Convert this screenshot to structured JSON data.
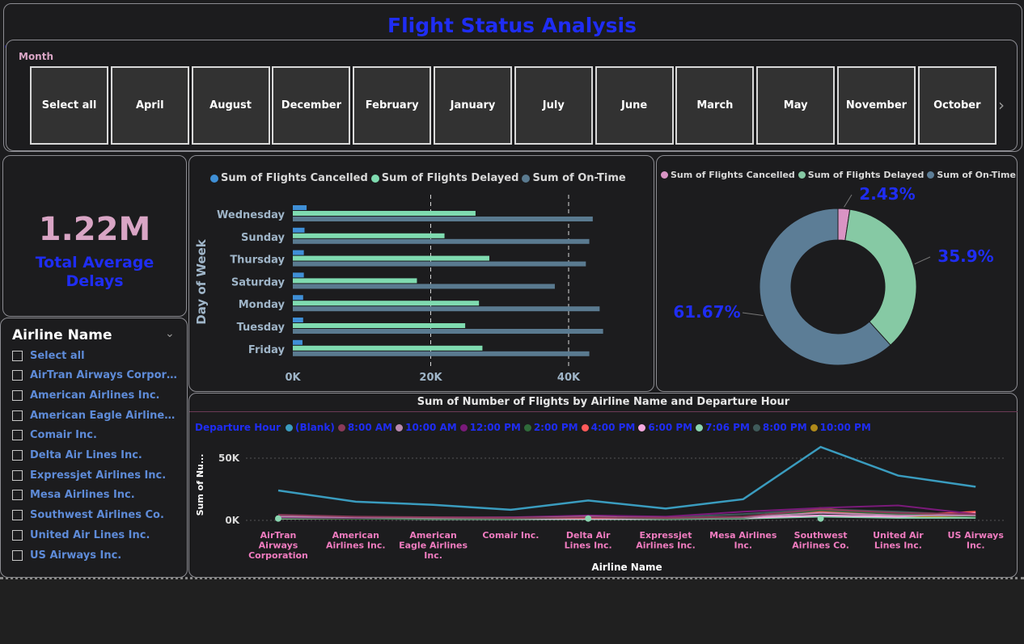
{
  "title": "Flight Status Analysis",
  "month_slicer": {
    "label": "Month",
    "items": [
      "Select all",
      "April",
      "August",
      "December",
      "February",
      "January",
      "July",
      "June",
      "March",
      "May",
      "November",
      "October"
    ],
    "scroll_icon": "chevron-right-icon"
  },
  "kpi": {
    "value": "1.22M",
    "label_line1": "Total Average",
    "label_line2": "Delays"
  },
  "airline_slicer": {
    "title": "Airline Name",
    "expand_icon": "chevron-down-icon",
    "items": [
      "Select all",
      "AirTran Airways Corporati...",
      "American Airlines Inc.",
      "American Eagle Airlines Inc.",
      "Comair Inc.",
      "Delta Air Lines Inc.",
      "Expressjet Airlines Inc.",
      "Mesa Airlines Inc.",
      "Southwest Airlines Co.",
      "United Air Lines Inc.",
      "US Airways Inc."
    ]
  },
  "colors": {
    "title": "#1f2df4",
    "kpi_value": "#d9a5c5",
    "cancelled": "#3f8fd6",
    "delayed": "#7fdbb0",
    "on_time": "#5a7a90",
    "axis_label": "#9fb5c8"
  },
  "chart_data": [
    {
      "type": "bar",
      "orientation": "horizontal",
      "ylabel": "Day of Week",
      "categories": [
        "Wednesday",
        "Sunday",
        "Thursday",
        "Saturday",
        "Monday",
        "Tuesday",
        "Friday"
      ],
      "series": [
        {
          "name": "Sum of Flights Cancelled",
          "values": [
            2000,
            1700,
            1600,
            1600,
            1500,
            1500,
            1400
          ]
        },
        {
          "name": "Sum of Flights Delayed",
          "values": [
            26500,
            22000,
            28500,
            18000,
            27000,
            25000,
            27500
          ]
        },
        {
          "name": "Sum of On-Time",
          "values": [
            43500,
            43000,
            42500,
            38000,
            44500,
            45000,
            43000
          ]
        }
      ],
      "xlim": [
        0,
        48000
      ],
      "xticks": [
        0,
        20000,
        40000
      ],
      "xtick_labels": [
        "0K",
        "20K",
        "40K"
      ],
      "grid": true
    },
    {
      "type": "pie",
      "donut": true,
      "labels": [
        "Sum of Flights Cancelled",
        "Sum of Flights Delayed",
        "Sum of On-Time"
      ],
      "values": [
        2.43,
        35.9,
        61.67
      ],
      "data_labels": [
        "2.43%",
        "35.9%",
        "61.67%"
      ],
      "colors": [
        "#d994c4",
        "#86c9a4",
        "#5c7d96"
      ]
    },
    {
      "type": "line",
      "title": "Sum of Number of Flights by Airline Name and Departure Hour",
      "xlabel": "Airline Name",
      "ylabel": "Sum of Nu...",
      "legend_title": "Departure Hour",
      "categories": [
        "AirTran Airways Corporation",
        "American Airlines Inc.",
        "American Eagle Airlines Inc.",
        "Comair Inc.",
        "Delta Air Lines Inc.",
        "Expressjet Airlines Inc.",
        "Mesa Airlines Inc.",
        "Southwest Airlines Co.",
        "United Air Lines Inc.",
        "US Airways Inc."
      ],
      "yticks": [
        0,
        50000
      ],
      "ytick_labels": [
        "0K",
        "50K"
      ],
      "ylim": [
        0,
        60000
      ],
      "series": [
        {
          "name": "(Blank)",
          "color": "#3a9cbf",
          "values": [
            24000,
            15000,
            12500,
            8500,
            16000,
            9500,
            17000,
            59000,
            36000,
            27000
          ]
        },
        {
          "name": "8:00 AM",
          "color": "#8a3a5a",
          "values": [
            4500,
            3000,
            2500,
            2000,
            2500,
            2000,
            3000,
            9000,
            6000,
            5000
          ]
        },
        {
          "name": "10:00 AM",
          "color": "#b98ab0",
          "values": [
            3000,
            2500,
            2000,
            2000,
            3000,
            2000,
            2500,
            6000,
            4000,
            4000
          ]
        },
        {
          "name": "12:00 PM",
          "color": "#7a1a7a",
          "values": [
            2500,
            2000,
            2500,
            2500,
            4000,
            3000,
            7000,
            10000,
            12000,
            5000
          ]
        },
        {
          "name": "2:00 PM",
          "color": "#2f6b3a",
          "values": [
            2000,
            1500,
            1500,
            1500,
            2500,
            1500,
            2000,
            8000,
            5000,
            3000
          ]
        },
        {
          "name": "4:00 PM",
          "color": "#ff5a5a",
          "values": [
            3000,
            2500,
            2000,
            2000,
            2000,
            2000,
            2500,
            7000,
            4000,
            7000
          ]
        },
        {
          "name": "6:00 PM",
          "color": "#f5a9e0",
          "values": [
            2500,
            2000,
            1500,
            1500,
            1500,
            1500,
            2000,
            4000,
            3000,
            6000
          ]
        },
        {
          "name": "7:06 PM",
          "color": "#8ad5b0",
          "values": [
            1500,
            1500,
            1000,
            1000,
            1000,
            1000,
            1500,
            3000,
            2000,
            2000
          ]
        },
        {
          "name": "8:00 PM",
          "color": "#3f5a5a",
          "values": [
            2000,
            2000,
            2000,
            2500,
            3000,
            2500,
            5000,
            9000,
            7000,
            4000
          ]
        },
        {
          "name": "10:00 PM",
          "color": "#b08a1a",
          "values": [
            1500,
            1500,
            1500,
            2000,
            2000,
            2000,
            2500,
            10000,
            3000,
            3000
          ]
        }
      ],
      "grid": true
    }
  ]
}
